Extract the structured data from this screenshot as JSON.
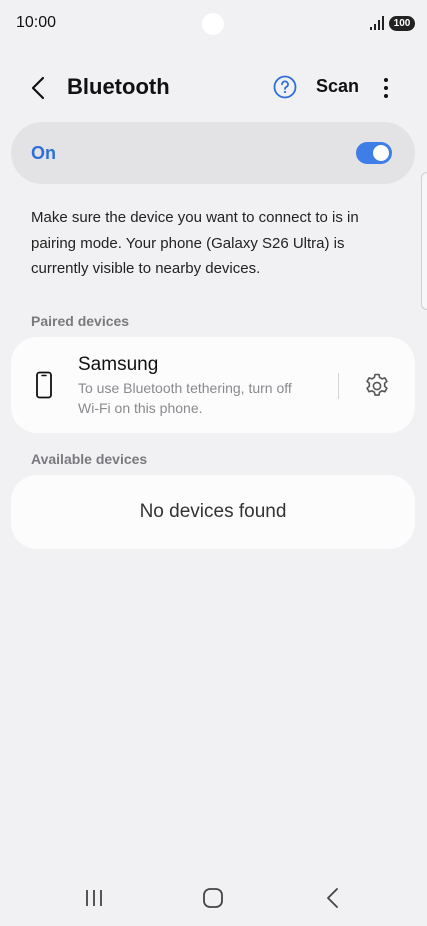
{
  "status_bar": {
    "time": "10:00",
    "battery": "100",
    "signal_icon": "signal-icon"
  },
  "header": {
    "title": "Bluetooth",
    "scan_label": "Scan",
    "back_icon": "back-arrow-icon",
    "help_icon": "help-icon",
    "more_icon": "more-vertical-icon"
  },
  "toggle": {
    "label": "On",
    "state": true,
    "accent_color": "#3f7ee6"
  },
  "description": "Make sure the device you want to connect to is in pairing mode. Your phone (Galaxy S26 Ultra) is currently visible to nearby devices.",
  "paired": {
    "section_label": "Paired devices",
    "devices": [
      {
        "name": "Samsung",
        "subtitle_line1": "To use Bluetooth tethering, turn off",
        "subtitle_line2": "Wi-Fi on this phone.",
        "icon": "smartphone-icon",
        "settings_icon": "gear-icon"
      }
    ]
  },
  "available": {
    "section_label": "Available devices",
    "empty_message": "No devices found"
  },
  "nav_bar": {
    "recent_icon": "recent-apps-icon",
    "home_icon": "home-icon",
    "back_icon": "back-icon"
  }
}
